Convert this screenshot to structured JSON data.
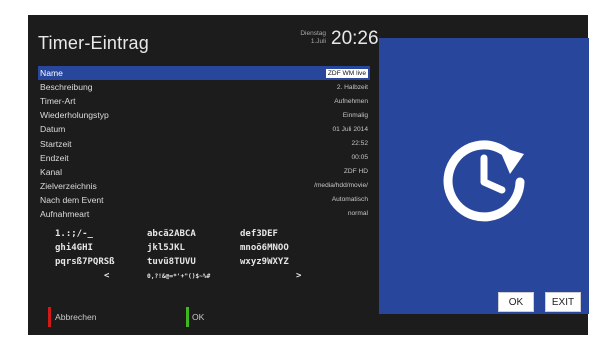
{
  "header": {
    "title": "Timer-Eintrag",
    "day_name": "Dienstag",
    "date_short": "1.Juli",
    "time": "20:26"
  },
  "fields": [
    {
      "label": "Name",
      "value": "ZDF WM live",
      "selected": true
    },
    {
      "label": "Beschreibung",
      "value": "2. Halbzeit"
    },
    {
      "label": "Timer-Art",
      "value": "Aufnehmen"
    },
    {
      "label": "Wiederholungstyp",
      "value": "Einmalig"
    },
    {
      "label": "Datum",
      "value": "01 Juli 2014"
    },
    {
      "label": "Startzeit",
      "value": "22:52"
    },
    {
      "label": "Endzeit",
      "value": "00:05"
    },
    {
      "label": "Kanal",
      "value": "ZDF HD"
    },
    {
      "label": "Zielverzeichnis",
      "value": "/media/hdd/movie/"
    },
    {
      "label": "Nach dem Event",
      "value": "Automatisch"
    },
    {
      "label": "Aufnahmeart",
      "value": "normal"
    }
  ],
  "keyboard": [
    [
      "1.:;/-_",
      "abcä2ABCA",
      "def3DEF"
    ],
    [
      "ghi4GHI",
      "jkl5JKL",
      "mnoö6MNOO"
    ],
    [
      "pqrsß7PQRSß",
      "tuvü8TUVU",
      "wxyz9WXYZ"
    ],
    [
      "<",
      "0,?!&@=*'+\"()$~%#",
      ">"
    ]
  ],
  "buttons": {
    "cancel": "Abbrechen",
    "ok_green": "OK",
    "ok": "OK",
    "exit": "EXIT"
  },
  "colors": {
    "selection": "#27469c",
    "red_key": "#d01919",
    "green_key": "#3fb81f"
  },
  "preview_icon": "timer-history-icon"
}
